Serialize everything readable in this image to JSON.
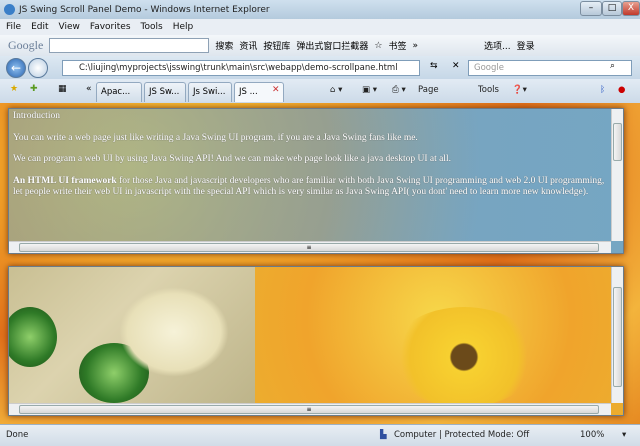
{
  "window": {
    "title": "JS Swing Scroll Panel Demo - Windows Internet Explorer",
    "minimize": "–",
    "maximize": "□",
    "close": "X"
  },
  "menu": [
    "File",
    "Edit",
    "View",
    "Favorites",
    "Tools",
    "Help"
  ],
  "google_bar": {
    "logo": "Google",
    "search_value": "",
    "search_btn": "搜索",
    "news": "资讯",
    "buttons": "按钮库",
    "popup_blocker": "弹出式窗口拦截器",
    "bookmarks": "书签",
    "more": "»",
    "options": "选项...",
    "login": "登录"
  },
  "address": {
    "url": "C:\\liujing\\myprojects\\jsswing\\trunk\\main\\src\\webapp\\demo-scrollpane.html",
    "search_placeholder": "Google"
  },
  "tabs": [
    {
      "label": "Apac..."
    },
    {
      "label": "JS Sw..."
    },
    {
      "label": "Js Swi..."
    },
    {
      "label": "JS ...",
      "active": true
    }
  ],
  "command_bar": {
    "page": "Page",
    "tools": "Tools"
  },
  "panel1": {
    "heading": "Introduction",
    "p1": "You can write a web page just like writing a Java Swing UI program, if you are a Java Swing fans like me.",
    "p2": "We can program a web UI by using Java Swing API! And we can make web page look like a java desktop UI at all.",
    "p3_bold": "An HTML UI framework",
    "p3": " for those Java and javascript developers who are familiar with both Java Swing UI programming and web 2.0 UI programming, let people write their web UI in javascript with the special API which is very similar as Java Swing API( you dont' need to learn more new knowledge)."
  },
  "status": {
    "text": "Done",
    "zone": "Computer | Protected Mode: Off",
    "zoom": "100%"
  }
}
